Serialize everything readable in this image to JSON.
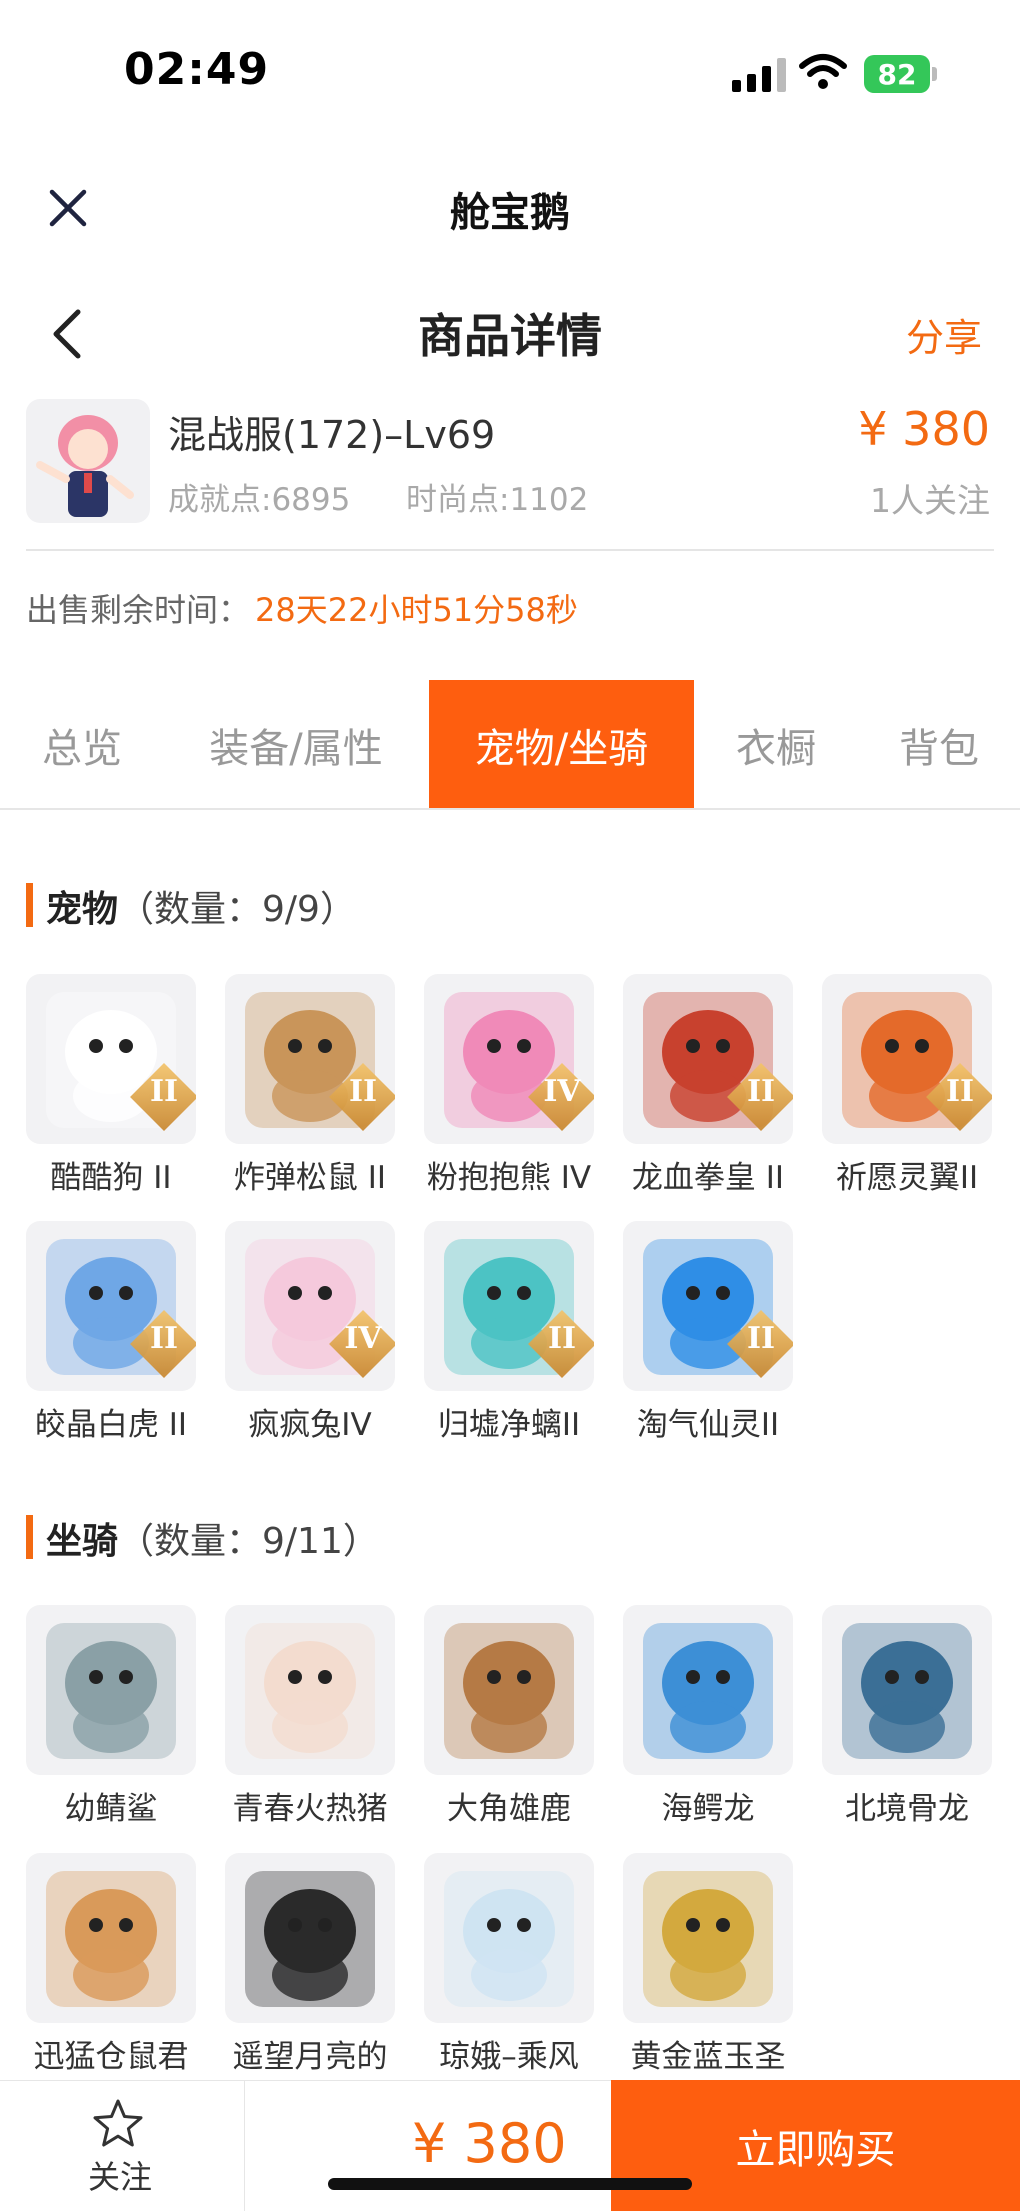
{
  "status": {
    "time": "02:49",
    "battery": "82"
  },
  "nav": {
    "app_title": "舱宝鹅",
    "page_title": "商品详情",
    "share": "分享"
  },
  "product": {
    "name": "混战服(172)–Lv69",
    "achievement": "成就点:6895",
    "fashion": "时尚点:1102",
    "price": "¥ 380",
    "followers": "1人关注",
    "remaining_label": "出售剩余时间：",
    "remaining_value": "28天22小时51分58秒"
  },
  "tabs": [
    "总览",
    "装备/属性",
    "宠物/坐骑",
    "衣橱",
    "背包"
  ],
  "active_tab": 2,
  "pets": {
    "title": "宠物",
    "count": "（数量：9/9）",
    "items": [
      {
        "name": "酷酷狗 II",
        "tier": "II",
        "color": "#ffffff"
      },
      {
        "name": "炸弹松鼠 II",
        "tier": "II",
        "color": "#c9955a"
      },
      {
        "name": "粉抱抱熊 IV",
        "tier": "IV",
        "color": "#f08ab8"
      },
      {
        "name": "龙血拳皇 II",
        "tier": "II",
        "color": "#c8412e"
      },
      {
        "name": "祈愿灵翼II",
        "tier": "II",
        "color": "#e46a2a"
      },
      {
        "name": "皎晶白虎 II",
        "tier": "II",
        "color": "#6fa7e6"
      },
      {
        "name": "疯疯兔IV",
        "tier": "IV",
        "color": "#f5c9dc"
      },
      {
        "name": "归墟净螭II",
        "tier": "II",
        "color": "#4cc3c4"
      },
      {
        "name": "淘气仙灵II",
        "tier": "II",
        "color": "#2f8ee6"
      }
    ]
  },
  "mounts": {
    "title": "坐骑",
    "count": "（数量：9/11）",
    "items": [
      {
        "name": "幼鲭鲨",
        "color": "#8aa0a6"
      },
      {
        "name": "青春火热猪",
        "color": "#f3dccf"
      },
      {
        "name": "大角雄鹿",
        "color": "#b57a45"
      },
      {
        "name": "海鳄龙",
        "color": "#3d8fd6"
      },
      {
        "name": "北境骨龙",
        "color": "#3b6f96"
      },
      {
        "name": "迅猛仓鼠君",
        "color": "#d99a5a"
      },
      {
        "name": "遥望月亮的",
        "color": "#2a2a2a"
      },
      {
        "name": "琼娥–乘风",
        "color": "#cfe4f2"
      },
      {
        "name": "黄金蓝玉圣",
        "color": "#d3a93e"
      }
    ]
  },
  "bottom": {
    "follow": "关注",
    "price": "¥ 380",
    "buy": "立即购买"
  }
}
